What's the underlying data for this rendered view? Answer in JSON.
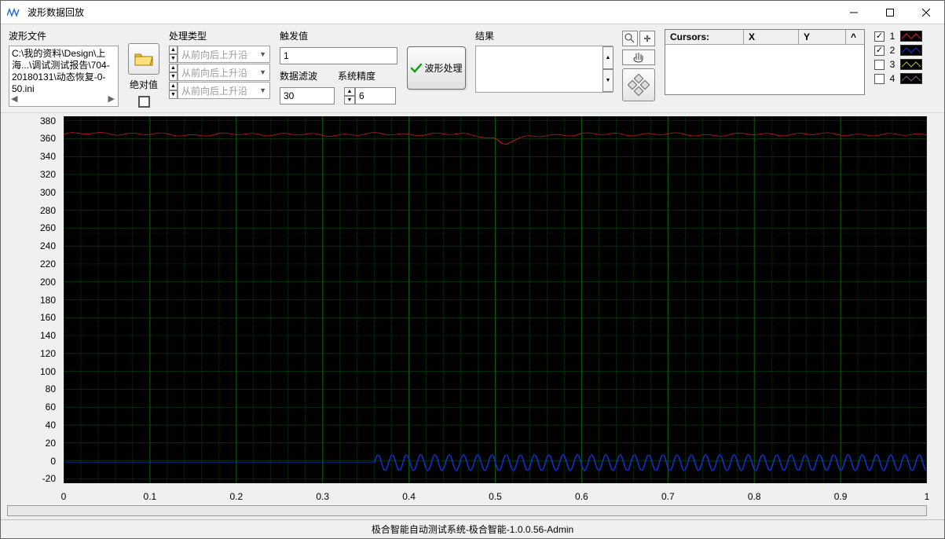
{
  "window": {
    "title": "波形数据回放"
  },
  "toolbar": {
    "file_label": "波形文件",
    "file_path": "C:\\我的资料\\Design\\上海...\\调试测试报告\\704-20180131\\动态恢复-0-50.ini",
    "abs_label": "绝对值",
    "abs_checked": false,
    "proc_type_label": "处理类型",
    "combo_option": "从前向后上升沿",
    "trigger_label": "触发值",
    "trigger_value": "1",
    "filter_label": "数据滤波",
    "filter_value": "30",
    "precision_label": "系统精度",
    "precision_value": "6",
    "process_btn": "波形处理",
    "result_label": "结果"
  },
  "cursors": {
    "title": "Cursors:",
    "col_x": "X",
    "col_y": "Y"
  },
  "legend": {
    "items": [
      {
        "num": "1",
        "checked": true,
        "color": "#d41a1a"
      },
      {
        "num": "2",
        "checked": true,
        "color": "#1030d0"
      },
      {
        "num": "3",
        "checked": false,
        "color": "#a8a830"
      },
      {
        "num": "4",
        "checked": false,
        "color": "#7a4f7e"
      }
    ]
  },
  "chart_data": {
    "type": "line",
    "xlabel": "",
    "ylabel": "",
    "xlim": [
      0,
      1
    ],
    "ylim": [
      -25,
      385
    ],
    "xticks": [
      0,
      0.1,
      0.2,
      0.3,
      0.4,
      0.5,
      0.6,
      0.7,
      0.8,
      0.9,
      1
    ],
    "yticks": [
      -20,
      0,
      20,
      40,
      60,
      80,
      100,
      120,
      140,
      160,
      180,
      200,
      220,
      240,
      260,
      280,
      300,
      320,
      340,
      360,
      380
    ],
    "series": [
      {
        "name": "1",
        "color": "#d41a1a",
        "noise": 1.2,
        "x": [
          0,
          0.05,
          0.1,
          0.15,
          0.2,
          0.25,
          0.3,
          0.35,
          0.4,
          0.45,
          0.48,
          0.5,
          0.51,
          0.52,
          0.54,
          0.56,
          0.6,
          0.65,
          0.7,
          0.75,
          0.8,
          0.85,
          0.9,
          0.95,
          1
        ],
        "y": [
          365,
          366,
          365,
          364,
          365,
          365,
          364,
          365,
          365,
          365,
          364,
          360,
          353,
          358,
          362,
          364,
          365,
          365,
          365,
          364,
          365,
          365,
          365,
          364,
          365
        ]
      },
      {
        "name": "2",
        "color": "#1030d0",
        "noise": 0,
        "x": [
          0,
          0.05,
          0.1,
          0.15,
          0.2,
          0.25,
          0.3,
          0.35,
          0.36,
          0.37,
          0.4,
          0.45,
          0.5,
          0.55,
          0.6,
          0.65,
          0.7,
          0.75,
          0.8,
          0.85,
          0.9,
          0.95,
          1
        ],
        "y": [
          -2,
          -2,
          -2,
          -2,
          -2,
          -2,
          -2,
          -2,
          -2,
          "osc",
          "osc",
          "osc",
          "osc",
          "osc",
          "osc",
          "osc",
          "osc",
          "osc",
          "osc",
          "osc",
          "osc",
          "osc",
          "osc"
        ],
        "osc_start": 0.36,
        "osc_base": -2,
        "osc_amp": 9,
        "osc_period": 0.0165
      }
    ]
  },
  "statusbar": "极合智能自动测试系统-极合智能-1.0.0.56-Admin"
}
